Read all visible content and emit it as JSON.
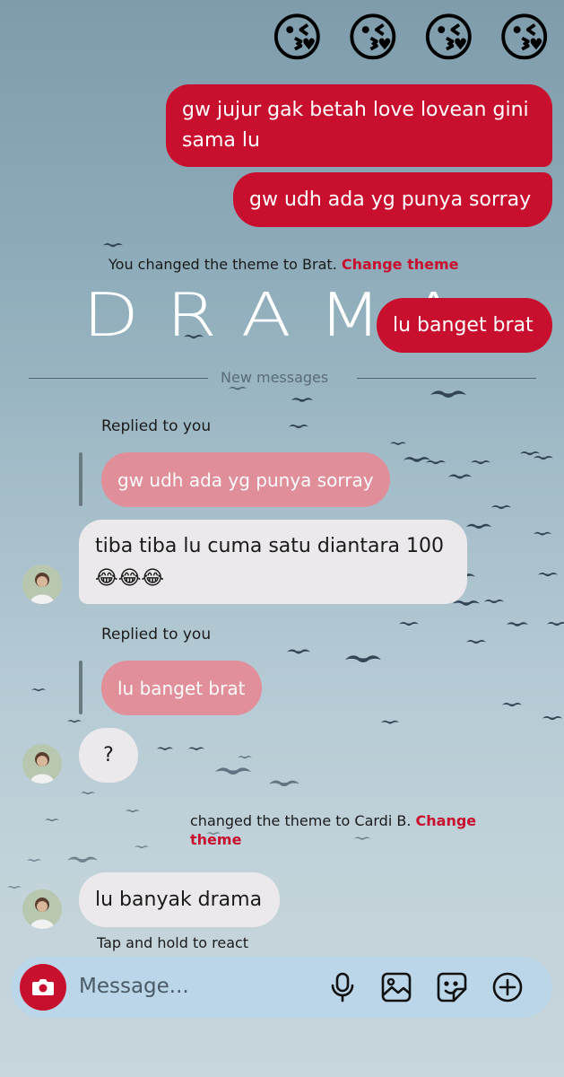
{
  "reactions": [
    "😘",
    "😘",
    "😘",
    "😘"
  ],
  "theme_overlay_text": "DRAMA",
  "messages": {
    "out1": "gw jujur gak betah love lovean gini sama lu",
    "out2": "gw udh ada yg punya sorray",
    "out3": "lu banget brat",
    "reply1_label": "Replied to you",
    "reply1_quote": "gw udh ada yg punya sorray",
    "in1": "tiba tiba lu cuma satu diantara 100 😂😂😂",
    "reply2_label": "Replied to you",
    "reply2_quote": "lu banget brat",
    "in2": "?",
    "in3": "lu banyak drama"
  },
  "system": {
    "theme1_text": "You changed the theme to Brat.",
    "theme1_link": "Change theme",
    "new_messages": "New messages",
    "theme2_text": "changed the theme to Cardi B.",
    "theme2_link": "Change theme"
  },
  "hint": "Tap and hold to react",
  "composer": {
    "placeholder": "Message...",
    "icons": [
      "camera-icon",
      "microphone-icon",
      "gallery-icon",
      "sticker-icon",
      "add-icon"
    ]
  },
  "colors": {
    "outgoing_bubble": "#c8102e",
    "incoming_bubble": "#ece9ec",
    "quoted_bubble": "#e48c97",
    "accent_link": "#c8102e",
    "composer_bg": "#bad6e8"
  }
}
